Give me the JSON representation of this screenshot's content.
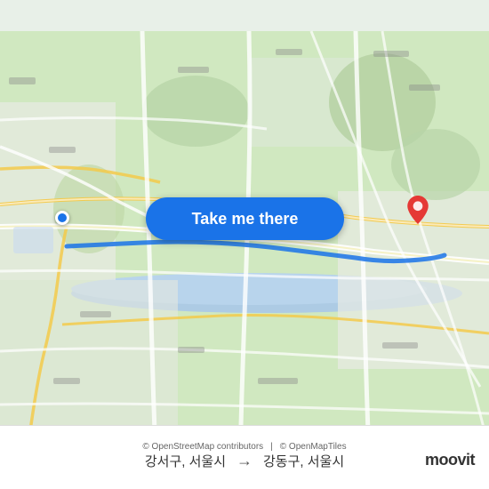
{
  "map": {
    "background_color": "#d4e6c3",
    "road_color": "#ffffff",
    "route_color": "#1a73e8"
  },
  "button": {
    "label": "Take me there",
    "bg_color": "#1a73e8"
  },
  "markers": {
    "start_color": "#1a73e8",
    "end_color": "#e53935"
  },
  "bottom_bar": {
    "origin": "강서구, 서울시",
    "destination": "강동구, 서울시",
    "arrow": "→",
    "copyright1": "© OpenStreetMap contributors",
    "copyright2": "© OpenMapTiles"
  },
  "moovit": {
    "logo": "moovit"
  }
}
